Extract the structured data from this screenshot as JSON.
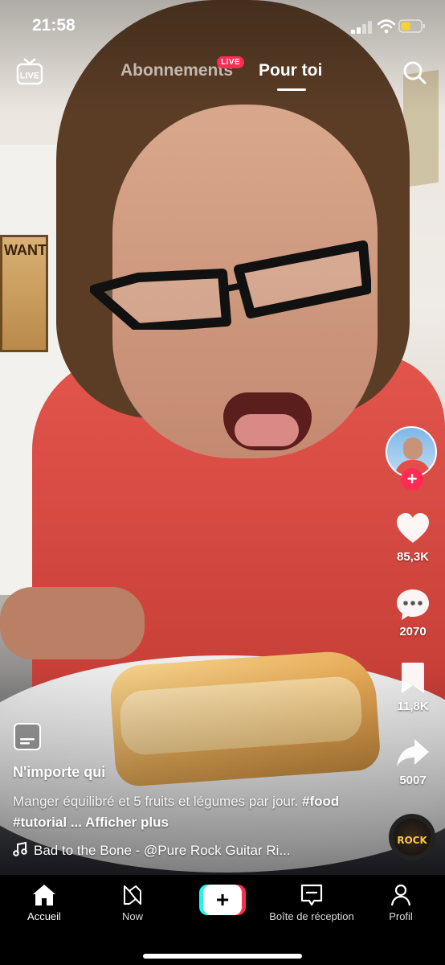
{
  "status_bar": {
    "time": "21:58"
  },
  "top_nav": {
    "live_icon_label": "LIVE",
    "tabs": [
      {
        "label": "Abonnements",
        "active": false
      },
      {
        "label": "Pour toi",
        "active": true
      }
    ],
    "live_badge": "LIVE"
  },
  "video": {
    "poster_text": "WANT"
  },
  "right_rail": {
    "follow_symbol": "+",
    "likes": "85,3K",
    "comments": "2070",
    "saves": "11,8K",
    "shares": "5007",
    "music_disc_text": "ROCK"
  },
  "caption": {
    "username": "N'importe qui",
    "text": "Manger équilibré et 5 fruits et légumes par jour.",
    "hashtags": "#food #tutorial",
    "more_link": "... Afficher plus",
    "music": "Bad to the Bone - @Pure Rock Guitar Ri..."
  },
  "bottom_nav": {
    "items": [
      {
        "label": "Accueil",
        "icon": "home-icon",
        "active": true
      },
      {
        "label": "Now",
        "icon": "now-icon",
        "active": false
      },
      {
        "label": "+",
        "icon": "create-icon",
        "active": false
      },
      {
        "label": "Boîte de réception",
        "icon": "inbox-icon",
        "active": false
      },
      {
        "label": "Profil",
        "icon": "profile-icon",
        "active": false
      }
    ]
  },
  "colors": {
    "accent": "#fe2c55",
    "cyan": "#25f4ee",
    "nav_bg": "#000000"
  }
}
